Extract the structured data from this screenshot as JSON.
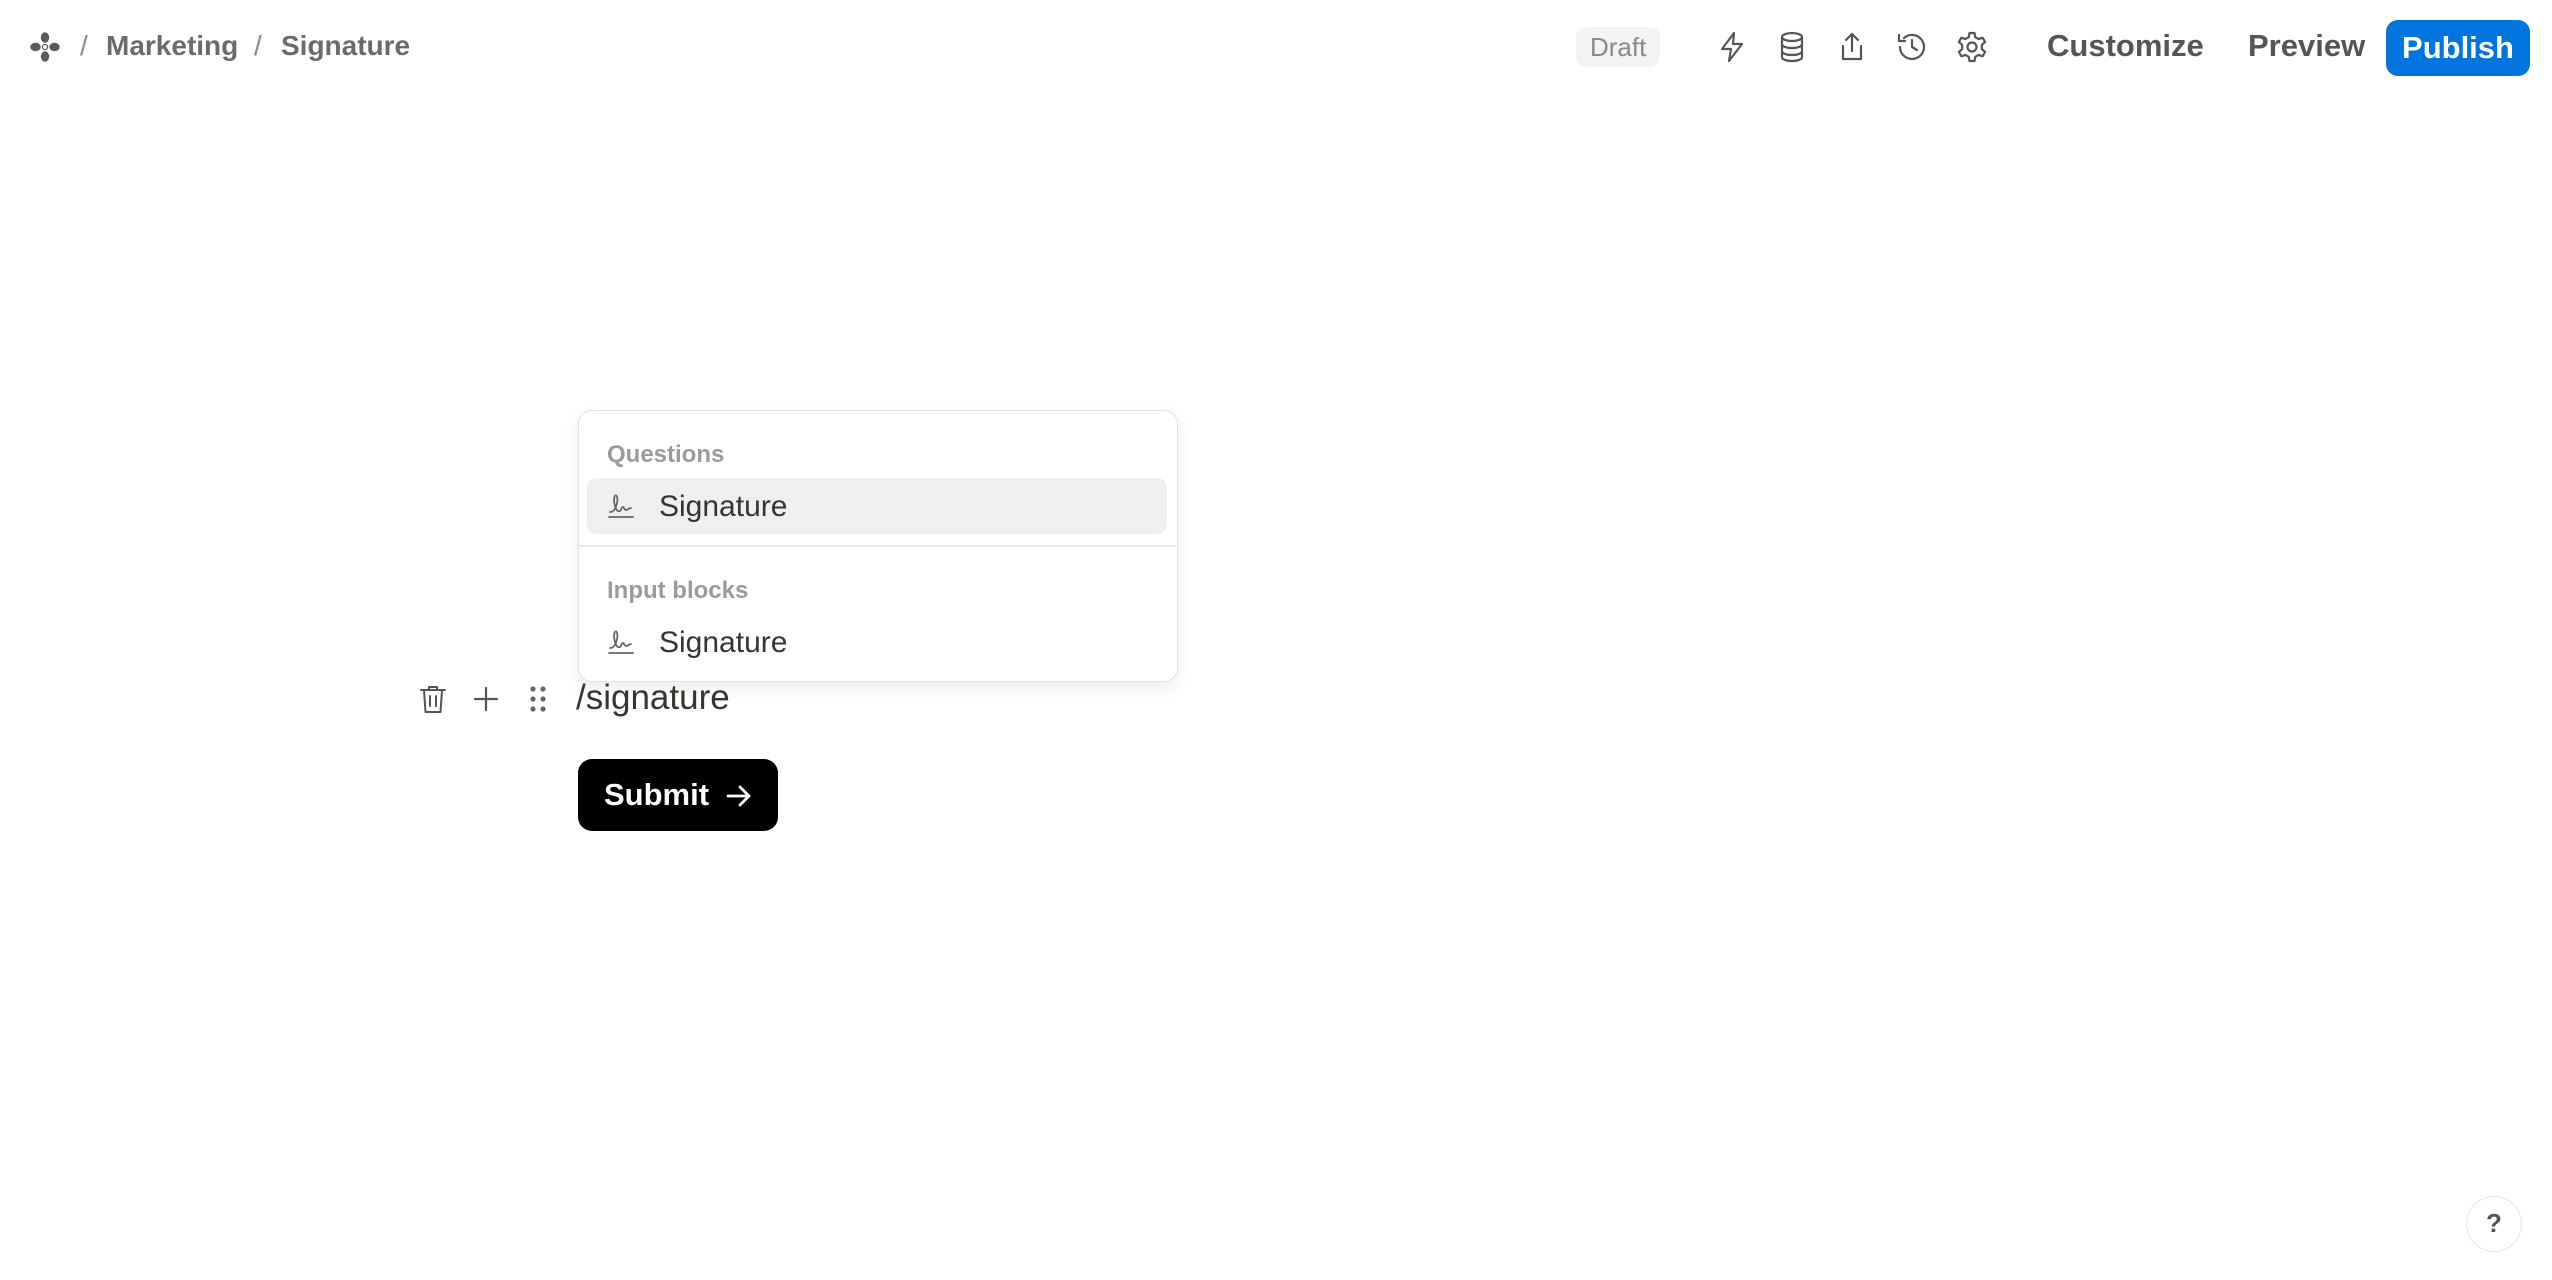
{
  "breadcrumb": {
    "separator": "/",
    "workspace": "Marketing",
    "page": "Signature"
  },
  "toolbar": {
    "status_badge": "Draft",
    "icons": [
      "lightning-icon",
      "database-icon",
      "share-icon",
      "history-icon",
      "settings-icon"
    ],
    "customize_label": "Customize",
    "preview_label": "Preview",
    "publish_label": "Publish"
  },
  "dropdown": {
    "sections": [
      {
        "header": "Questions",
        "items": [
          {
            "label": "Signature",
            "icon": "signature-icon",
            "highlighted": true
          }
        ]
      },
      {
        "header": "Input blocks",
        "items": [
          {
            "label": "Signature",
            "icon": "signature-icon",
            "highlighted": false
          }
        ]
      }
    ]
  },
  "editor": {
    "command_text": "/signature"
  },
  "form": {
    "submit_label": "Submit"
  },
  "help": {
    "label": "?"
  },
  "colors": {
    "publish": "#0075de",
    "submit": "#000000",
    "highlight": "#efefef"
  }
}
